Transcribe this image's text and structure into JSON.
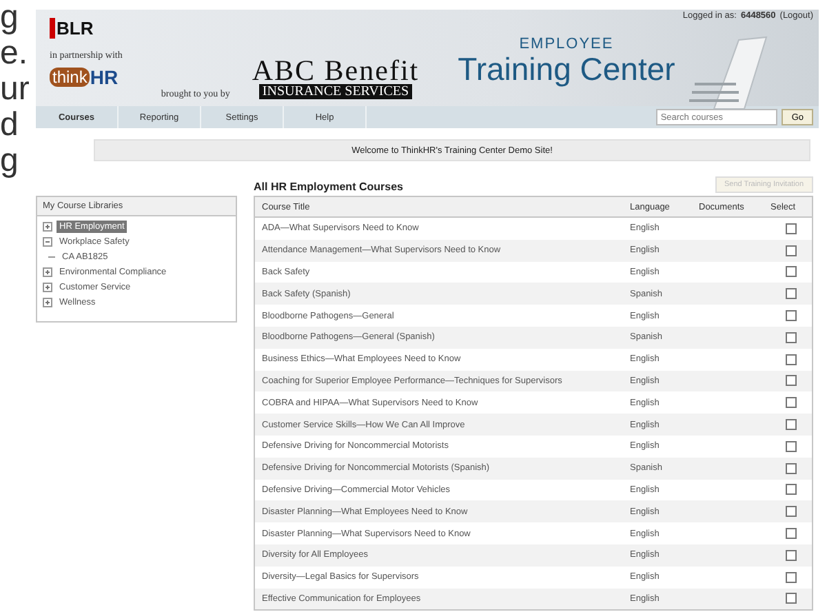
{
  "outside_text": [
    "g",
    "e.",
    "ur",
    "d",
    "g"
  ],
  "header": {
    "logged_in_label": "Logged in as:",
    "user": "6448560",
    "logout": "(Logout)",
    "blr_logo": "BLR",
    "partnership": "in partnership with",
    "thinkhr_think": "think",
    "thinkhr_hr": "HR",
    "brought_by": "brought to you by",
    "abc_top": "ABC Benefit",
    "abc_bottom": "INSURANCE SERVICES",
    "title_small": "EMPLOYEE",
    "title_large": "Training Center"
  },
  "nav": {
    "tabs": [
      {
        "label": "Courses",
        "selected": true
      },
      {
        "label": "Reporting",
        "selected": false
      },
      {
        "label": "Settings",
        "selected": false
      },
      {
        "label": "Help",
        "selected": false
      }
    ],
    "search": {
      "placeholder": "Search courses"
    },
    "go": "Go"
  },
  "welcome": "Welcome to ThinkHR's Training Center Demo Site!",
  "sidebar": {
    "title": "My Course Libraries",
    "items": [
      {
        "label": "HR Employment",
        "selected": true,
        "expanded": false
      },
      {
        "label": "Workplace Safety",
        "selected": false,
        "expanded": true,
        "children": [
          {
            "label": "CA AB1825",
            "selected": false
          }
        ]
      },
      {
        "label": "Environmental Compliance",
        "selected": false,
        "expanded": false
      },
      {
        "label": "Customer Service",
        "selected": false,
        "expanded": false
      },
      {
        "label": "Wellness",
        "selected": false,
        "expanded": false
      }
    ]
  },
  "courses": {
    "title": "All HR Employment Courses",
    "invite_button": {
      "label": "Send Training Invitation",
      "disabled": true
    },
    "columns": [
      "Course Title",
      "Language",
      "Documents",
      "Select"
    ],
    "rows": [
      {
        "title": "ADA—What Supervisors Need to Know",
        "language": "English",
        "checked": false
      },
      {
        "title": "Attendance Management—What Supervisors Need to Know",
        "language": "English",
        "checked": false
      },
      {
        "title": "Back Safety",
        "language": "English",
        "checked": false
      },
      {
        "title": "Back Safety (Spanish)",
        "language": "Spanish",
        "checked": false
      },
      {
        "title": "Bloodborne Pathogens—General",
        "language": "English",
        "checked": false
      },
      {
        "title": "Bloodborne Pathogens—General (Spanish)",
        "language": "Spanish",
        "checked": false
      },
      {
        "title": "Business Ethics—What Employees Need to Know",
        "language": "English",
        "checked": false
      },
      {
        "title": "Coaching for Superior Employee Performance—Techniques for Supervisors",
        "language": "English",
        "checked": false
      },
      {
        "title": "COBRA and HIPAA—What Supervisors Need to Know",
        "language": "English",
        "checked": false
      },
      {
        "title": "Customer Service Skills—How We Can All Improve",
        "language": "English",
        "checked": false
      },
      {
        "title": "Defensive Driving for Noncommercial Motorists",
        "language": "English",
        "checked": false
      },
      {
        "title": "Defensive Driving for Noncommercial Motorists (Spanish)",
        "language": "Spanish",
        "checked": false
      },
      {
        "title": "Defensive Driving—Commercial Motor Vehicles",
        "language": "English",
        "checked": false
      },
      {
        "title": "Disaster Planning—What Employees Need to Know",
        "language": "English",
        "checked": false
      },
      {
        "title": "Disaster Planning—What Supervisors Need to Know",
        "language": "English",
        "checked": false
      },
      {
        "title": "Diversity for All Employees",
        "language": "English",
        "checked": false
      },
      {
        "title": "Diversity—Legal Basics for Supervisors",
        "language": "English",
        "checked": false
      },
      {
        "title": "Effective Communication for Employees",
        "language": "English",
        "checked": false
      }
    ]
  }
}
